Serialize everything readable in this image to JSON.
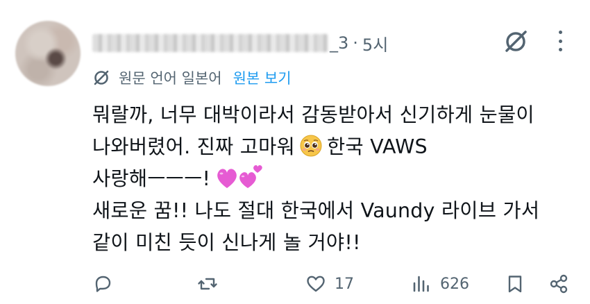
{
  "post": {
    "handle_tail": "_3",
    "dot": "·",
    "time": "5시",
    "translation": {
      "label": "원문 언어 일본어",
      "show_original": "원본 보기"
    },
    "body_lines": [
      "뭐랄까, 너무 대박이라서 감동받아서 신기하게 눈물이",
      "나와버렸어. 진짜 고마워",
      "한국 VAWS",
      "사랑해ㅡㅡㅡ!",
      "새로운 꿈!! 나도 절대 한국에서 Vaundy 라이브 가서",
      "같이 미친 듯이 신나게 놀 거야!!"
    ],
    "emoji": [
      "pleading-face-emoji",
      "two-hearts-emoji"
    ],
    "actions": {
      "reply_count": "",
      "repost_count": "",
      "like_count": "17",
      "views_count": "626"
    }
  },
  "colors": {
    "text": "#0f1419",
    "muted": "#536471",
    "link": "#1d9bf0",
    "heart_pink": "#e65bd3"
  }
}
